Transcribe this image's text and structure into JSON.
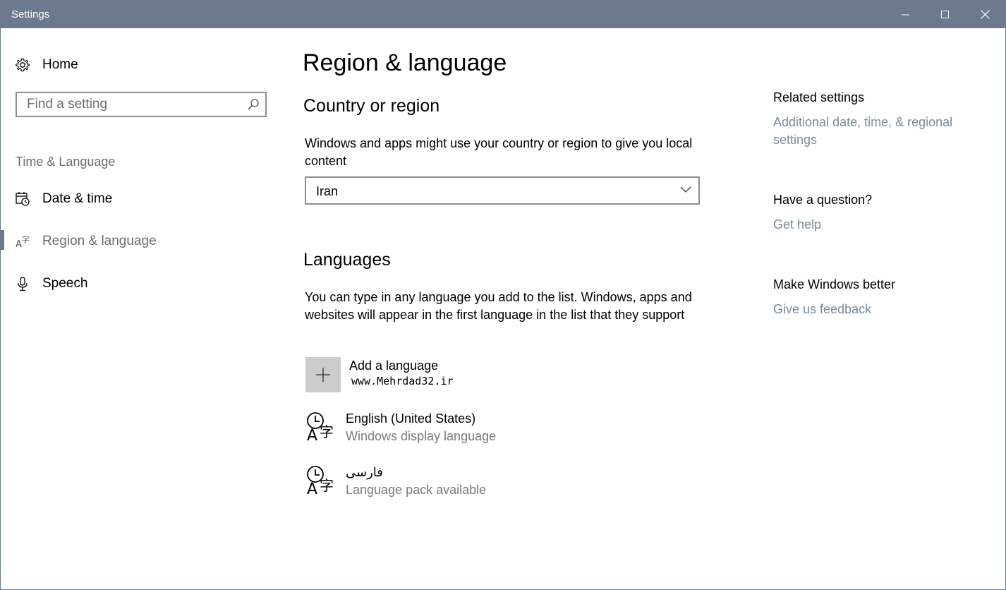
{
  "window": {
    "title": "Settings"
  },
  "sidebar": {
    "home_label": "Home",
    "search_placeholder": "Find a setting",
    "section_label": "Time & Language",
    "items": [
      {
        "label": "Date & time",
        "icon": "calendar-clock-icon"
      },
      {
        "label": "Region & language",
        "icon": "region-language-icon",
        "selected": true
      },
      {
        "label": "Speech",
        "icon": "microphone-icon"
      }
    ]
  },
  "main": {
    "page_title": "Region & language",
    "country": {
      "heading": "Country or region",
      "description": "Windows and apps might use your country or region to give you local content",
      "selected": "Iran"
    },
    "languages": {
      "heading": "Languages",
      "description": "You can type in any language you add to the list. Windows, apps and websites will appear in the first language in the list that they support",
      "add_label": "Add a language",
      "watermark": "www.Mehrdad32.ir",
      "items": [
        {
          "name": "English (United States)",
          "status": "Windows display language"
        },
        {
          "name": "فارسی",
          "status": "Language pack available"
        }
      ]
    }
  },
  "related": {
    "related_heading": "Related settings",
    "related_link": "Additional date, time, & regional settings",
    "question_heading": "Have a question?",
    "question_link": "Get help",
    "better_heading": "Make Windows better",
    "better_link": "Give us feedback"
  },
  "colors": {
    "titlebar": "#6b7a8f",
    "link": "#7a8a9a",
    "secondary_text": "#7a7a7a"
  }
}
